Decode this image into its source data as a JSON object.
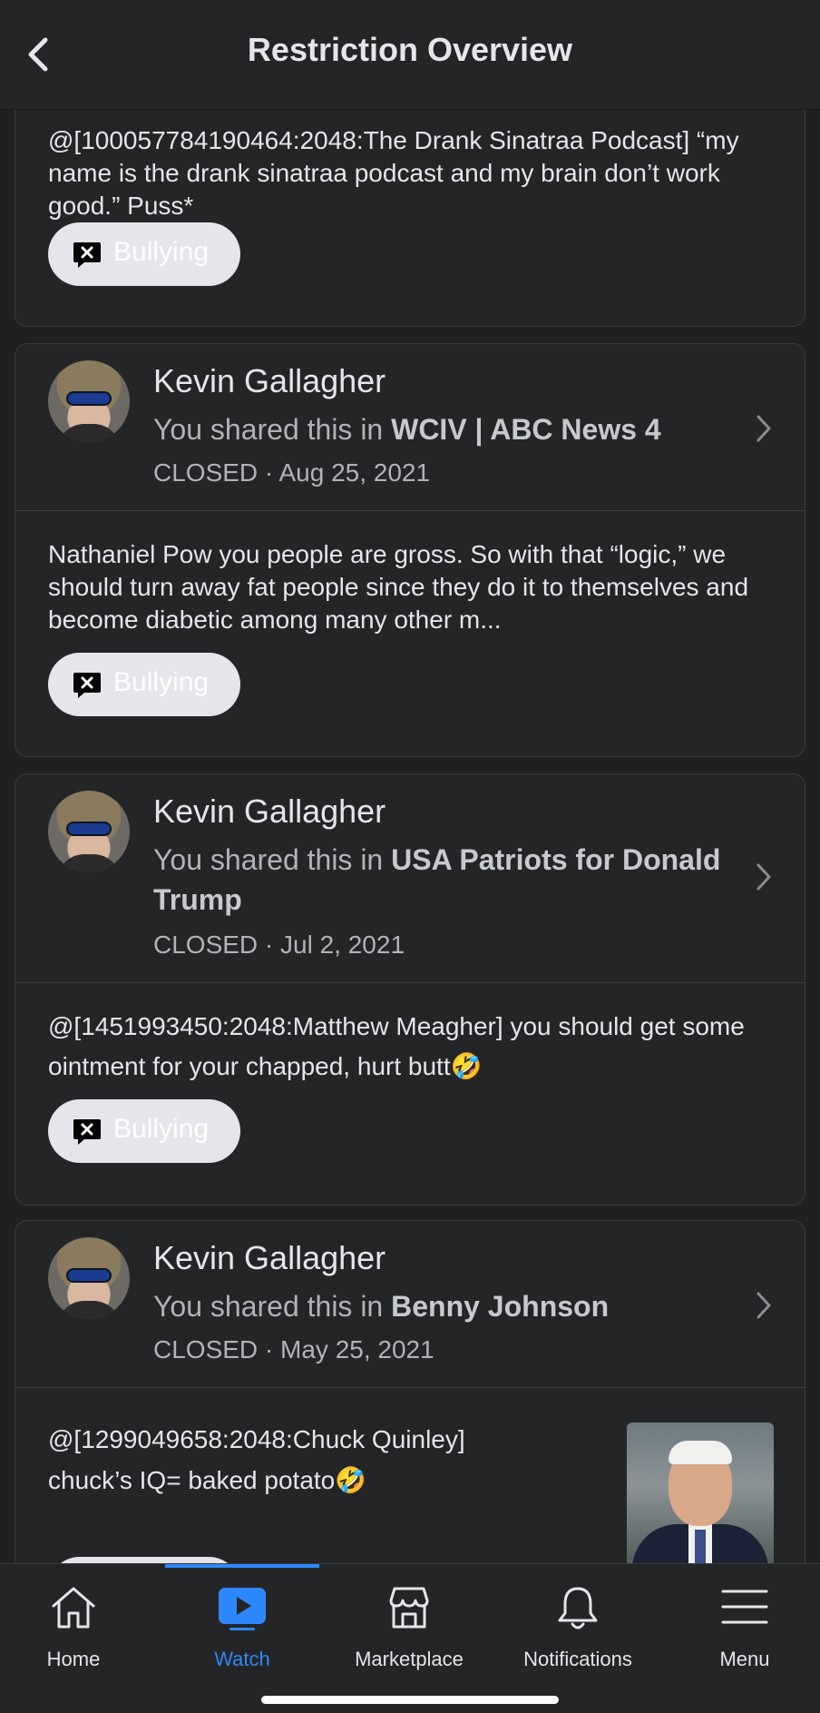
{
  "header": {
    "title": "Restriction Overview"
  },
  "cards": [
    {
      "text": "@[100057784190464:2048:The Drank Sinatraa Podcast] “my name is the drank sinatraa podcast and my brain don’t work good.” Puss*",
      "tag": "Bullying"
    },
    {
      "name": "Kevin Gallagher",
      "shared_prefix": "You shared this in ",
      "group": "WCIV | ABC News 4",
      "status": "CLOSED · Aug 25, 2021",
      "text": "Nathaniel Pow you people are gross. So with that “logic,” we should turn away fat people since they do it to themselves and become diabetic among many other m...",
      "tag": "Bullying"
    },
    {
      "name": "Kevin Gallagher",
      "shared_prefix": "You shared this in ",
      "group": "USA Patriots for Donald Trump",
      "status": "CLOSED · Jul 2, 2021",
      "text": "@[1451993450:2048:Matthew Meagher] you should get some ointment for your chapped, hurt butt🤣",
      "tag": "Bullying"
    },
    {
      "name": "Kevin Gallagher",
      "shared_prefix": "You shared this in ",
      "group": "Benny Johnson",
      "status": "CLOSED · May 25, 2021",
      "text_line1": "@[1299049658:2048:Chuck Quinley]",
      "text_line2": "chuck’s IQ= baked potato🤣"
    }
  ],
  "nav": [
    {
      "label": "Home",
      "icon": "home-icon"
    },
    {
      "label": "Watch",
      "icon": "watch-icon",
      "active": true
    },
    {
      "label": "Marketplace",
      "icon": "marketplace-icon"
    },
    {
      "label": "Notifications",
      "icon": "bell-icon"
    },
    {
      "label": "Menu",
      "icon": "menu-icon"
    }
  ],
  "colors": {
    "accent": "#2d88ff",
    "background": "#1f2022",
    "card": "#242526",
    "pill": "#e4e6eb"
  }
}
